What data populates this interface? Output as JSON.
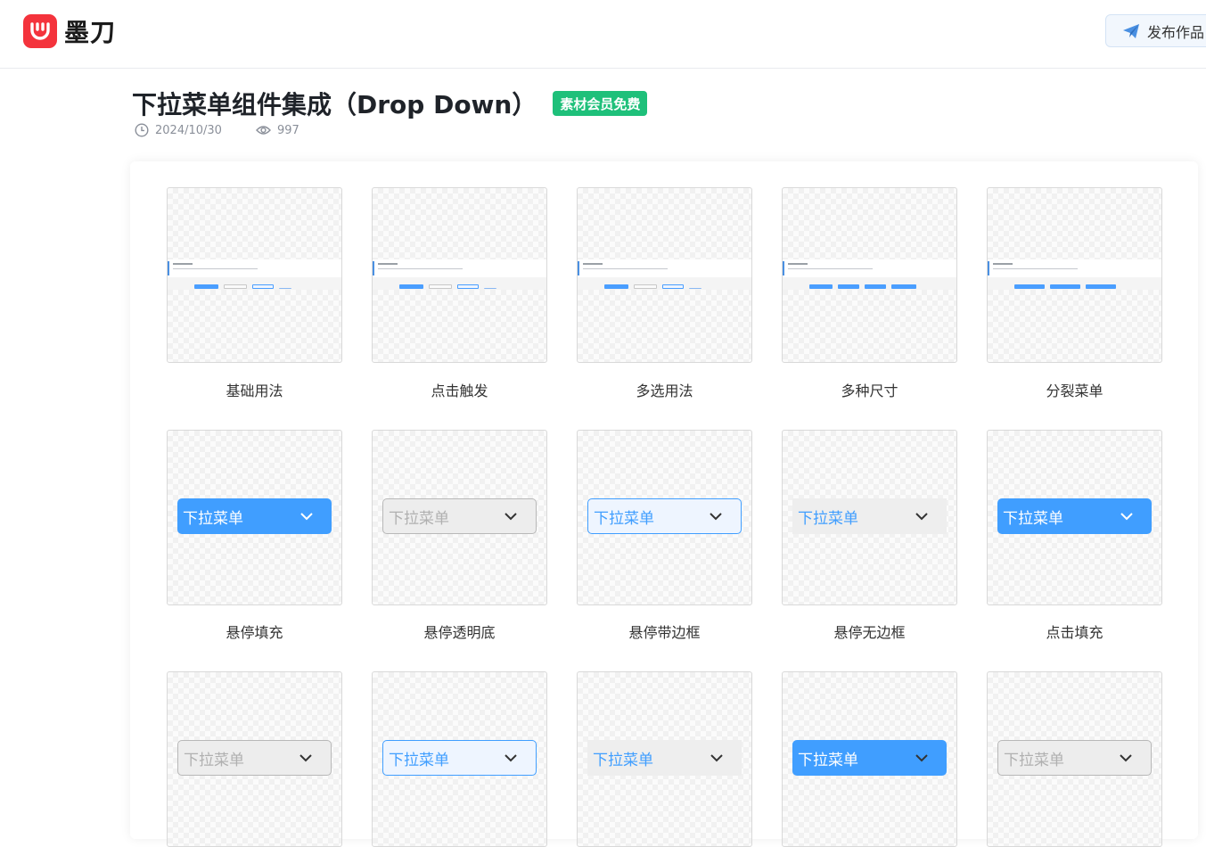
{
  "header": {
    "logo_text": "墨刀",
    "publish_label": "发布作品"
  },
  "page": {
    "title": "下拉菜单组件集成（Drop Down）",
    "badge": "素材会员免费",
    "date": "2024/10/30",
    "views": "997"
  },
  "gallery": {
    "row1": [
      {
        "caption": "基础用法"
      },
      {
        "caption": "点击触发"
      },
      {
        "caption": "多选用法"
      },
      {
        "caption": "多种尺寸"
      },
      {
        "caption": "分裂菜单"
      }
    ],
    "row2": [
      {
        "caption": "悬停填充",
        "style": "fill"
      },
      {
        "caption": "悬停透明底",
        "style": "gray"
      },
      {
        "caption": "悬停带边框",
        "style": "bord"
      },
      {
        "caption": "悬停无边框",
        "style": "noborder"
      },
      {
        "caption": "点击填充",
        "style": "fill"
      }
    ],
    "row3": [
      {
        "style": "gray"
      },
      {
        "style": "bord"
      },
      {
        "style": "noborder"
      },
      {
        "style": "fill"
      },
      {
        "style": "gray"
      }
    ],
    "dropdown_label": "下拉菜单"
  },
  "icons": {
    "clock": "clock-icon",
    "eye": "eye-icon",
    "send": "paper-plane-icon",
    "chevron": "chevron-down-icon"
  },
  "colors": {
    "brand_red": "#f4333c",
    "badge_green": "#1ec07a",
    "primary_blue": "#409eff"
  }
}
